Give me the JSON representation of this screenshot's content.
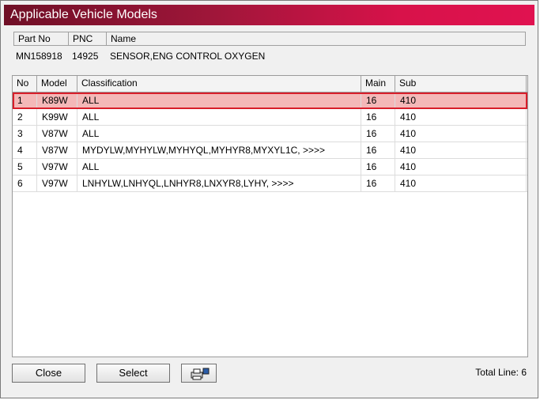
{
  "window": {
    "title": "Applicable Vehicle Models"
  },
  "part_info": {
    "headers": [
      "Part No",
      "PNC",
      "Name"
    ],
    "values": [
      "MN158918",
      "14925",
      "SENSOR,ENG CONTROL OXYGEN"
    ]
  },
  "table": {
    "columns": [
      "No",
      "Model",
      "Classification",
      "Main",
      "Sub"
    ],
    "rows": [
      [
        "1",
        "K89W",
        "ALL",
        "16",
        "410"
      ],
      [
        "2",
        "K99W",
        "ALL",
        "16",
        "410"
      ],
      [
        "3",
        "V87W",
        "ALL",
        "16",
        "410"
      ],
      [
        "4",
        "V87W",
        "MYDYLW,MYHYLW,MYHYQL,MYHYR8,MYXYL1C,  >>>>",
        "16",
        "410"
      ],
      [
        "5",
        "V97W",
        "ALL",
        "16",
        "410"
      ],
      [
        "6",
        "V97W",
        "LNHYLW,LNHYQL,LNHYR8,LNXYR8,LYHY,  >>>>",
        "16",
        "410"
      ]
    ]
  },
  "buttons": {
    "close": "Close",
    "select": "Select"
  },
  "status": {
    "total_line": "Total Line: 6"
  },
  "icons": {
    "print": "printer-icon"
  },
  "colors": {
    "title_start": "#6f0f26",
    "title_end": "#e01250",
    "selected_row": "#f4b8b8",
    "selected_border": "#d81e2a"
  }
}
